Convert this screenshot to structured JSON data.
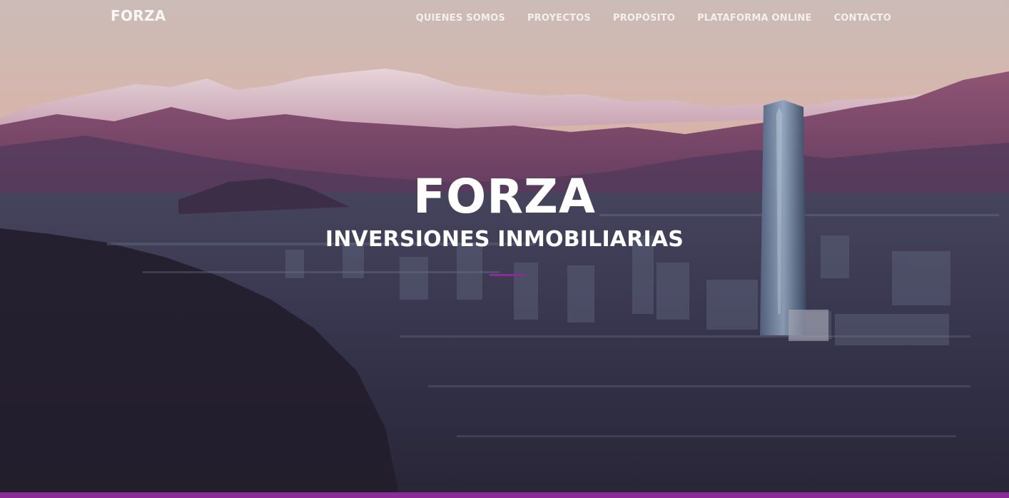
{
  "nav": {
    "brand": "FORZA",
    "links": [
      {
        "label": "QUIENES SOMOS"
      },
      {
        "label": "PROYECTOS"
      },
      {
        "label": "PROPÓSITO"
      },
      {
        "label": "PLATAFORMA ONLINE"
      },
      {
        "label": "CONTACTO"
      }
    ]
  },
  "hero": {
    "title": "FORZA",
    "subtitle": "INVERSIONES INMOBILIARIAS",
    "background_image": "santiago-skyline-andes-photo"
  },
  "colors": {
    "accent": "#8a2c98",
    "text": "#ffffff",
    "sky_top": "#d9c6bd",
    "sky_bottom": "#efc2b5"
  }
}
